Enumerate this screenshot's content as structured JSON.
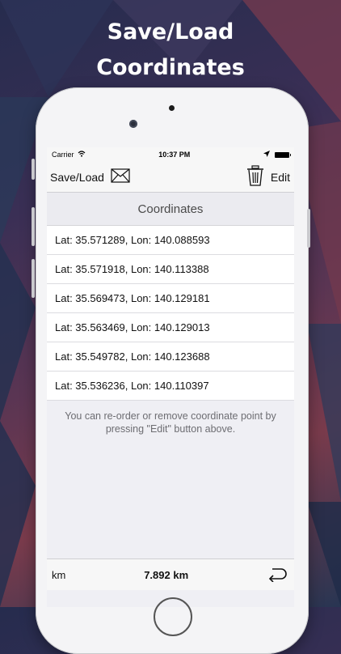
{
  "headline": {
    "line1": "Save/Load",
    "line2": "Coordinates"
  },
  "status": {
    "carrier": "Carrier",
    "time": "10:37 PM"
  },
  "toolbar": {
    "save_load_label": "Save/Load",
    "edit_label": "Edit"
  },
  "section": {
    "title": "Coordinates"
  },
  "coordinates": [
    "Lat: 35.571289, Lon: 140.088593",
    "Lat: 35.571918, Lon: 140.113388",
    "Lat: 35.569473, Lon: 140.129181",
    "Lat: 35.563469, Lon: 140.129013",
    "Lat: 35.549782, Lon: 140.123688",
    "Lat: 35.536236, Lon: 140.110397"
  ],
  "note": "You can re-order or remove coordinate point by pressing \"Edit\" button above.",
  "bottom": {
    "unit_label": "km",
    "distance": "7.892 km"
  },
  "icons": {
    "mail": "envelope-icon",
    "trash": "trash-icon",
    "undo": "undo-arrow-icon",
    "wifi": "wifi-icon",
    "location": "location-arrow-icon",
    "battery": "battery-icon"
  }
}
